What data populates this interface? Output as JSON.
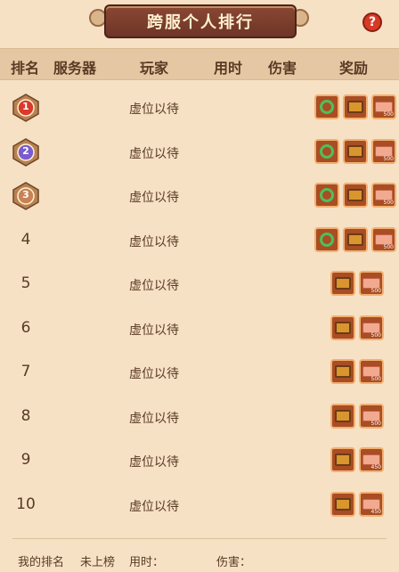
{
  "title": "跨服个人排行",
  "help_label": "?",
  "headers": {
    "rank": "排名",
    "server": "服务器",
    "player": "玩家",
    "time": "用时",
    "damage": "伤害",
    "reward": "奖励"
  },
  "rows": [
    {
      "rank": "1",
      "player": "虚位以待",
      "rewards": [
        {
          "icon": "green-ring-icon"
        },
        {
          "icon": "treasure-chest-icon"
        },
        {
          "icon": "ticket-icon",
          "qty": "500"
        }
      ]
    },
    {
      "rank": "2",
      "player": "虚位以待",
      "rewards": [
        {
          "icon": "green-ring-icon"
        },
        {
          "icon": "treasure-chest-icon"
        },
        {
          "icon": "ticket-icon",
          "qty": "500"
        }
      ]
    },
    {
      "rank": "3",
      "player": "虚位以待",
      "rewards": [
        {
          "icon": "green-ring-icon"
        },
        {
          "icon": "treasure-chest-icon"
        },
        {
          "icon": "ticket-icon",
          "qty": "500"
        }
      ]
    },
    {
      "rank": "4",
      "player": "虚位以待",
      "rewards": [
        {
          "icon": "green-ring-icon"
        },
        {
          "icon": "treasure-chest-icon"
        },
        {
          "icon": "ticket-icon",
          "qty": "500"
        }
      ]
    },
    {
      "rank": "5",
      "player": "虚位以待",
      "rewards": [
        {
          "icon": "treasure-chest-icon"
        },
        {
          "icon": "ticket-icon",
          "qty": "500"
        }
      ]
    },
    {
      "rank": "6",
      "player": "虚位以待",
      "rewards": [
        {
          "icon": "treasure-chest-icon"
        },
        {
          "icon": "ticket-icon",
          "qty": "500"
        }
      ]
    },
    {
      "rank": "7",
      "player": "虚位以待",
      "rewards": [
        {
          "icon": "treasure-chest-icon"
        },
        {
          "icon": "ticket-icon",
          "qty": "500"
        }
      ]
    },
    {
      "rank": "8",
      "player": "虚位以待",
      "rewards": [
        {
          "icon": "treasure-chest-icon"
        },
        {
          "icon": "ticket-icon",
          "qty": "500"
        }
      ]
    },
    {
      "rank": "9",
      "player": "虚位以待",
      "rewards": [
        {
          "icon": "treasure-chest-icon"
        },
        {
          "icon": "ticket-icon",
          "qty": "450"
        }
      ]
    },
    {
      "rank": "10",
      "player": "虚位以待",
      "rewards": [
        {
          "icon": "treasure-chest-icon"
        },
        {
          "icon": "ticket-icon",
          "qty": "450"
        }
      ]
    }
  ],
  "footer": {
    "my_rank_label": "我的排名",
    "my_rank_value": "未上榜",
    "time_label": "用时：",
    "damage_label": "伤害："
  },
  "colors": {
    "gold": "#d93a2b",
    "silver": "#7b5ccf",
    "bronze": "#c98255",
    "background": "#f6e1c5"
  }
}
